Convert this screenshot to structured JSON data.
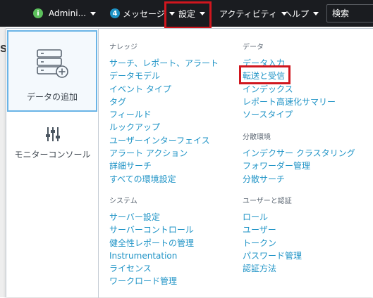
{
  "topbar": {
    "account_label": "Admini...",
    "messages_count": "4",
    "messages_label": "メッセージ",
    "settings_label": "設定",
    "activity_label": "アクティビティ",
    "help_label": "ヘルプ",
    "search_placeholder": "検索"
  },
  "background": {
    "letter": "s"
  },
  "sidebar": {
    "add_data_label": "データの追加",
    "monitoring_console_label": "モニターコンソール"
  },
  "sections": {
    "knowledge": {
      "title": "ナレッジ",
      "items": [
        "サーチ、レポート、アラート",
        "データモデル",
        "イベント タイプ",
        "タグ",
        "フィールド",
        "ルックアップ",
        "ユーザーインターフェイス",
        "アラート アクション",
        "詳細サーチ",
        "すべての環境設定"
      ]
    },
    "system": {
      "title": "システム",
      "items": [
        "サーバー設定",
        "サーバーコントロール",
        "健全性レポートの管理",
        "Instrumentation",
        "ライセンス",
        "ワークロード管理"
      ]
    },
    "data": {
      "title": "データ",
      "items": [
        "データ入力",
        "転送と受信",
        "インデックス",
        "レポート高速化サマリー",
        "ソースタイプ"
      ]
    },
    "distributed": {
      "title": "分散環境",
      "items": [
        "インデクサー クラスタリング",
        "フォワーダー管理",
        "分散サーチ"
      ]
    },
    "users_auth": {
      "title": "ユーザーと認証",
      "items": [
        "ロール",
        "ユーザー",
        "トークン",
        "パスワード管理",
        "認証方法"
      ]
    }
  },
  "colors": {
    "topbar_bg": "#1a1c20",
    "link": "#1e93c6",
    "highlight": "#d0161e",
    "tile_border": "#6ab4e6"
  },
  "icons": {
    "info": "info-circle-icon",
    "add_data": "add-data-icon",
    "monitor": "sliders-icon"
  }
}
